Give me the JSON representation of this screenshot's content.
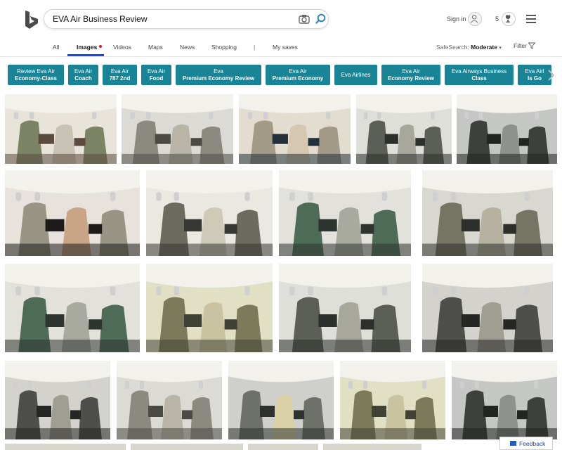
{
  "search": {
    "query": "EVA Air Business Review"
  },
  "account": {
    "signin_label": "Sign in",
    "rewards_count": "5"
  },
  "nav": {
    "tabs": [
      {
        "label": "All",
        "active": false
      },
      {
        "label": "Images",
        "active": true
      },
      {
        "label": "Videos",
        "active": false
      },
      {
        "label": "Maps",
        "active": false
      },
      {
        "label": "News",
        "active": false
      },
      {
        "label": "Shopping",
        "active": false
      },
      {
        "label": "|",
        "active": false
      },
      {
        "label": "My saves",
        "active": false
      }
    ],
    "safesearch_label": "SafeSearch:",
    "safesearch_value": "Moderate",
    "filter_label": "Filter"
  },
  "chips": [
    {
      "line1": "Review Eva Air",
      "line2": "Economy-Class"
    },
    {
      "line1": "Eva Air",
      "line2": "Coach"
    },
    {
      "line1": "Eva Air",
      "line2": "787 2nd"
    },
    {
      "line1": "Eva Air",
      "line2": "Food"
    },
    {
      "line1": "Eva",
      "line2": "Premium Economy Review"
    },
    {
      "line1": "Eva Air",
      "line2": "Premium Economy"
    },
    {
      "line1": "Eva Airlines",
      "line2": ""
    },
    {
      "line1": "Eva Air",
      "line2": "Economy Review"
    },
    {
      "line1": "Eva Airways Business",
      "line2": "Class"
    },
    {
      "line1": "Eva Airl",
      "line2": "Is Go"
    }
  ],
  "feedback_label": "Feedback",
  "colors": {
    "accent": "#174ae4",
    "chip_bg": "#1a8497",
    "badge_red": "#e81123"
  },
  "images": [
    {
      "kind": "seat-green",
      "alt": "Business class seat with green panel"
    },
    {
      "kind": "cabin",
      "alt": "Cabin view with passengers"
    },
    {
      "kind": "screen",
      "alt": "Passenger watching seat screen"
    },
    {
      "kind": "rows",
      "alt": "Rows of business seats"
    },
    {
      "kind": "rows-dark",
      "alt": "Dark business cabin rows"
    },
    {
      "kind": "selfie",
      "alt": "Passenger selfie in seat"
    },
    {
      "kind": "seat-close",
      "alt": "Seat close-up with pillow"
    },
    {
      "kind": "cabin-crew",
      "alt": "Cabin with crew"
    },
    {
      "kind": "cabin-front",
      "alt": "Front view of business cabin"
    },
    {
      "kind": "cabin-crew",
      "alt": "Crew walking in aisle"
    },
    {
      "kind": "seat-bright",
      "alt": "Bright seat with window"
    },
    {
      "kind": "rows",
      "alt": "Seat rows angled view"
    },
    {
      "kind": "seat-dark",
      "alt": "Seat with side console"
    },
    {
      "kind": "seat-dark",
      "alt": "Dark seat close-up"
    },
    {
      "kind": "cabin",
      "alt": "Cabin with screen"
    },
    {
      "kind": "seat-blanket",
      "alt": "Seats with patterned blankets"
    },
    {
      "kind": "seat-bright",
      "alt": "Seat with pillow"
    },
    {
      "kind": "rows-dark",
      "alt": "Seats from behind"
    }
  ]
}
